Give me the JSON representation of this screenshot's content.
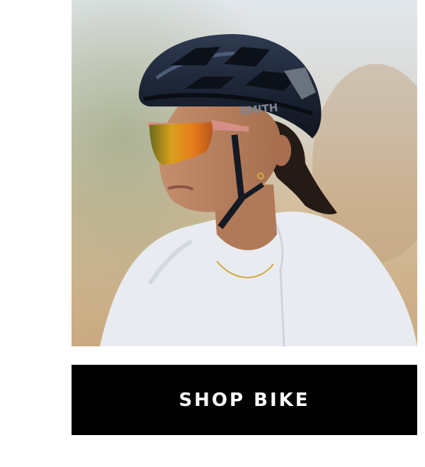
{
  "hero": {
    "image_name": "cyclist-helmet-photo",
    "helmet_brand": "SMITH",
    "colors": {
      "sky": "#dfe5ea",
      "background_warm": "#d6c2a4",
      "helmet": "#1c2533",
      "lens": "#e2a21a",
      "jersey": "#e9edf2",
      "skin": "#b57e5c",
      "hair": "#241a16"
    }
  },
  "cta": {
    "label": "SHOP BIKE",
    "background": "#000000",
    "text_color": "#ffffff"
  }
}
